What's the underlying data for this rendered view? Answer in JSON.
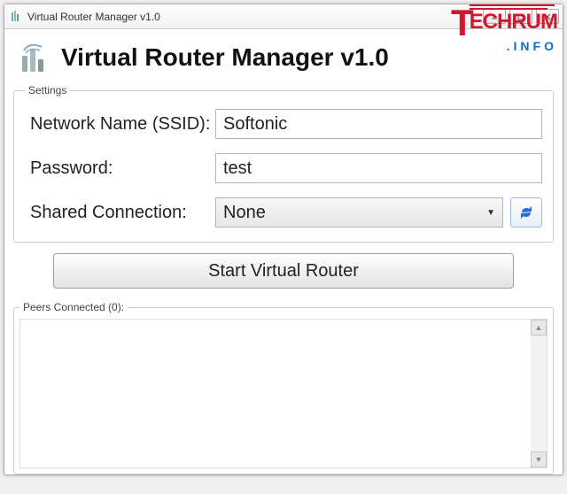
{
  "window": {
    "title": "Virtual Router Manager v1.0"
  },
  "app": {
    "heading": "Virtual Router Manager v1.0"
  },
  "watermark": {
    "brand_t": "T",
    "brand_rest": "ECHRUM",
    "suffix": ".INFO"
  },
  "settings": {
    "legend": "Settings",
    "ssid_label": "Network Name (SSID):",
    "ssid_value": "Softonic",
    "password_label": "Password:",
    "password_value": "test",
    "shared_label": "Shared Connection:",
    "shared_value": "None"
  },
  "actions": {
    "start_label": "Start Virtual Router"
  },
  "peers": {
    "legend": "Peers Connected (0):"
  }
}
